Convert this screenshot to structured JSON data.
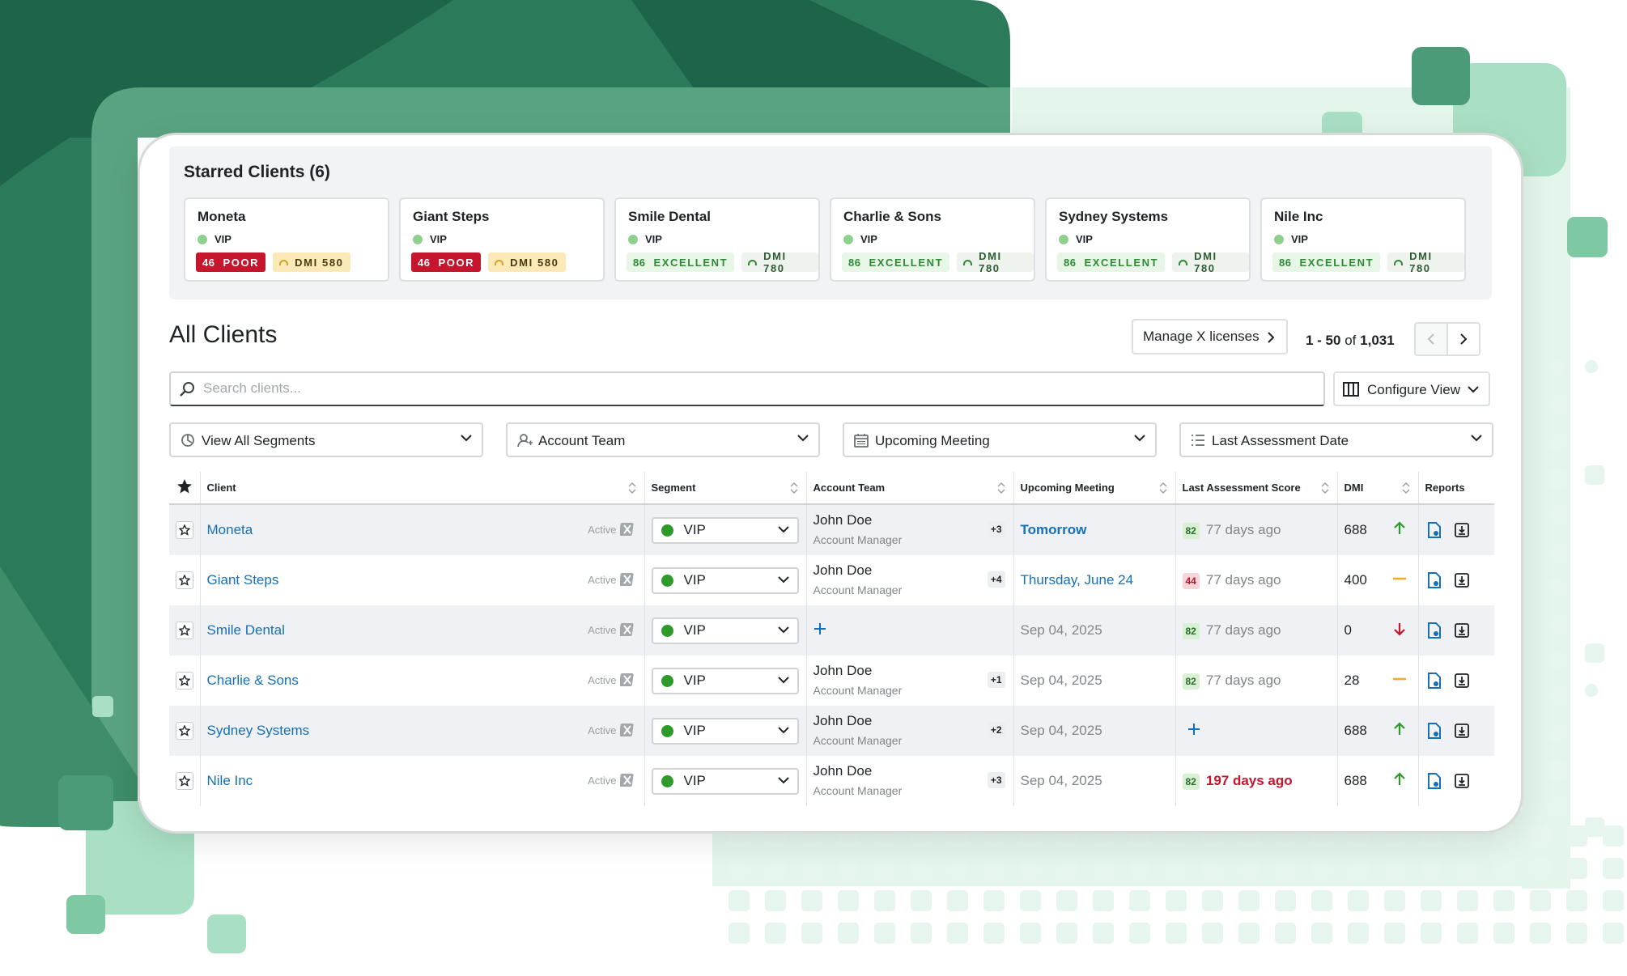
{
  "starred": {
    "title": "Starred Clients (6)",
    "cards": [
      {
        "name": "Moneta",
        "segment": "VIP",
        "score": "46",
        "rating": "POOR",
        "dmi": "DMI 580",
        "status": "poor"
      },
      {
        "name": "Giant Steps",
        "segment": "VIP",
        "score": "46",
        "rating": "POOR",
        "dmi": "DMI 580",
        "status": "poor"
      },
      {
        "name": "Smile Dental",
        "segment": "VIP",
        "score": "86",
        "rating": "EXCELLENT",
        "dmi": "DMI 780",
        "status": "good"
      },
      {
        "name": "Charlie & Sons",
        "segment": "VIP",
        "score": "86",
        "rating": "EXCELLENT",
        "dmi": "DMI 780",
        "status": "good"
      },
      {
        "name": "Sydney Systems",
        "segment": "VIP",
        "score": "86",
        "rating": "EXCELLENT",
        "dmi": "DMI 780",
        "status": "good"
      },
      {
        "name": "Nile Inc",
        "segment": "VIP",
        "score": "86",
        "rating": "EXCELLENT",
        "dmi": "DMI 780",
        "status": "good"
      }
    ]
  },
  "clients": {
    "title": "All Clients",
    "manage_label": "Manage X licenses",
    "pager": {
      "range": "1 - 50",
      "of": "of",
      "total": "1,031"
    },
    "search_placeholder": "Search clients...",
    "configure_label": "Configure View",
    "filters": [
      "View All Segments",
      "Account Team",
      "Upcoming Meeting",
      "Last Assessment Date"
    ],
    "columns": [
      "Client",
      "Segment",
      "Account Team",
      "Upcoming Meeting",
      "Last Assessment Score",
      "DMI",
      "Reports"
    ],
    "active_label": "Active",
    "rows": [
      {
        "name": "Moneta",
        "segment": "VIP",
        "team_name": "John Doe",
        "team_role": "Account Manager",
        "team_extra": "+3",
        "meeting": "Tomorrow",
        "meeting_style": "soon",
        "score": "82",
        "score_state": "good",
        "ago": "77 days ago",
        "ago_state": "normal",
        "dmi": "688",
        "trend": "up"
      },
      {
        "name": "Giant Steps",
        "segment": "VIP",
        "team_name": "John Doe",
        "team_role": "Account Manager",
        "team_extra": "+4",
        "meeting": "Thursday, June 24",
        "meeting_style": "blue",
        "score": "44",
        "score_state": "bad",
        "ago": "77 days ago",
        "ago_state": "normal",
        "dmi": "400",
        "trend": "flat"
      },
      {
        "name": "Smile Dental",
        "segment": "VIP",
        "team_name": "",
        "team_role": "",
        "team_extra": "",
        "meeting": "Sep 04, 2025",
        "meeting_style": "gray",
        "score": "82",
        "score_state": "good",
        "ago": "77 days ago",
        "ago_state": "normal",
        "dmi": "0",
        "trend": "down"
      },
      {
        "name": "Charlie & Sons",
        "segment": "VIP",
        "team_name": "John Doe",
        "team_role": "Account Manager",
        "team_extra": "+1",
        "meeting": "Sep 04, 2025",
        "meeting_style": "gray",
        "score": "82",
        "score_state": "good",
        "ago": "77 days ago",
        "ago_state": "normal",
        "dmi": "28",
        "trend": "flat"
      },
      {
        "name": "Sydney Systems",
        "segment": "VIP",
        "team_name": "John Doe",
        "team_role": "Account Manager",
        "team_extra": "+2",
        "meeting": "Sep 04, 2025",
        "meeting_style": "gray",
        "score": "",
        "score_state": "none",
        "ago": "",
        "ago_state": "normal",
        "dmi": "688",
        "trend": "up"
      },
      {
        "name": "Nile Inc",
        "segment": "VIP",
        "team_name": "John Doe",
        "team_role": "Account Manager",
        "team_extra": "+3",
        "meeting": "Sep 04, 2025",
        "meeting_style": "gray",
        "score": "82",
        "score_state": "good",
        "ago": "197 days ago",
        "ago_state": "late",
        "dmi": "688",
        "trend": "up"
      }
    ]
  },
  "colors": {
    "brand_dark": "#1e6448",
    "brand_mid": "#5aa381",
    "brand_light": "#a9e0c4",
    "link": "#1470b8",
    "poor": "#c5162d",
    "good": "#2e9a2a"
  },
  "icons": [
    "search-icon",
    "columns-icon",
    "chevron-right-icon",
    "chevron-left-icon",
    "chevron-down-icon",
    "segment-icon",
    "user-icon",
    "calendar-icon",
    "list-icon",
    "star-icon",
    "sort-icon",
    "x-logo-icon",
    "report-icon",
    "download-icon",
    "trend-up-icon",
    "trend-flat-icon",
    "trend-down-icon",
    "add-icon"
  ]
}
